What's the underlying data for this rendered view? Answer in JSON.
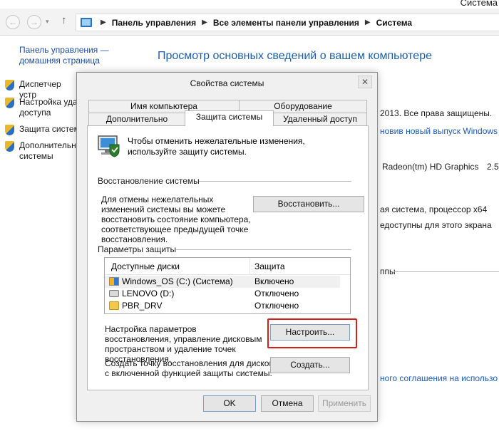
{
  "window_title": "Система",
  "breadcrumb": [
    "Панель управления",
    "Все элементы панели управления",
    "Система"
  ],
  "sidebar": {
    "home_link": "Панель управления — домашняя страница",
    "items": [
      {
        "label": "Диспетчер устр"
      },
      {
        "label": "Настройка уда доступа"
      },
      {
        "label": "Защита систем"
      },
      {
        "label": "Дополнительн системы"
      }
    ]
  },
  "main": {
    "heading": "Просмотр основных сведений о вашем компьютере",
    "fragments": [
      "2013. Все права защищены.",
      "новив новый выпуск Windows",
      "Radeon(tm) HD Graphics",
      "2.50",
      "ая система, процессор x64",
      "едоступны для этого экрана",
      "ппы",
      "ного соглашения на использо"
    ]
  },
  "dialog": {
    "title": "Свойства системы",
    "close_label": "✕",
    "tabs_top": [
      "Имя компьютера",
      "Оборудование"
    ],
    "tabs_bottom": [
      "Дополнительно",
      "Защита системы",
      "Удаленный доступ"
    ],
    "active_tab": "Защита системы",
    "intro": "Чтобы отменить нежелательные изменения, используйте защиту системы.",
    "restore_group": "Восстановление системы",
    "restore_desc": "Для отмены нежелательных изменений системы вы можете восстановить состояние компьютера, соответствующее предыдущей точке восстановления.",
    "restore_button": "Восстановить...",
    "protection_group": "Параметры защиты",
    "drives_table": {
      "headers": [
        "Доступные диски",
        "Защита"
      ],
      "rows": [
        {
          "name": "Windows_OS (C:) (Система)",
          "status": "Включено",
          "icon": "windows-drive-icon"
        },
        {
          "name": "LENOVO (D:)",
          "status": "Отключено",
          "icon": "drive-icon"
        },
        {
          "name": "PBR_DRV",
          "status": "Отключено",
          "icon": "folder-icon"
        }
      ]
    },
    "configure_desc": "Настройка параметров восстановления, управление дисковым пространством и удаление точек восстановления.",
    "configure_button": "Настроить...",
    "create_desc": "Создать точку восстановления для дисков с включенной функцией защиты системы.",
    "create_button": "Создать...",
    "ok_button": "OK",
    "cancel_button": "Отмена",
    "apply_button": "Применить",
    "highlight_color": "#d7201b"
  }
}
